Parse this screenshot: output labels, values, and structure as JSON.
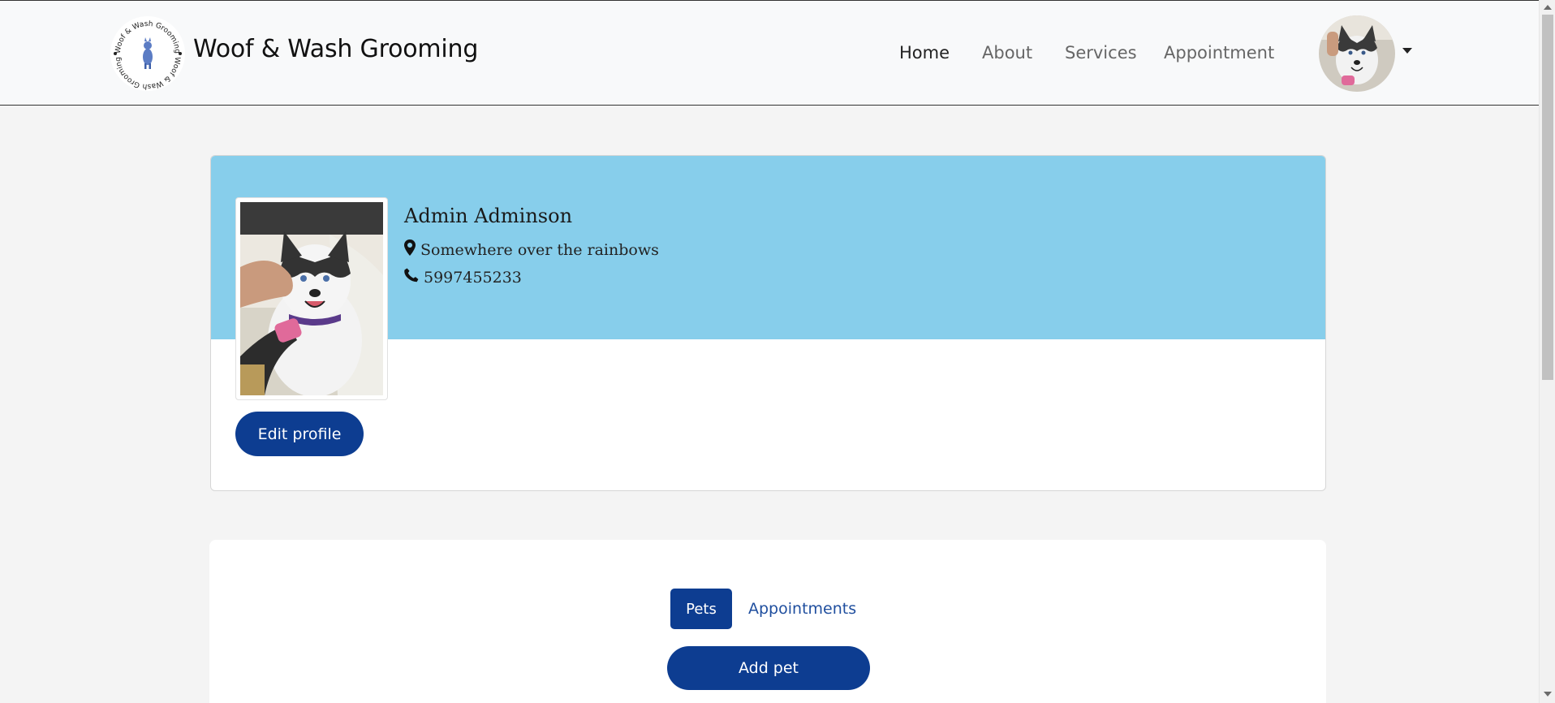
{
  "brand": {
    "title": "Woof & Wash Grooming",
    "logo_text": "Woof & Wash Grooming"
  },
  "nav": {
    "items": [
      {
        "label": "Home",
        "active": true
      },
      {
        "label": "About",
        "active": false
      },
      {
        "label": "Services",
        "active": false
      },
      {
        "label": "Appointment",
        "active": false
      }
    ]
  },
  "profile": {
    "name": "Admin Adminson",
    "location": "Somewhere over the rainbows",
    "phone": "5997455233",
    "edit_label": "Edit profile"
  },
  "tabs": {
    "items": [
      {
        "label": "Pets",
        "active": true
      },
      {
        "label": "Appointments",
        "active": false
      }
    ],
    "add_pet_label": "Add pet"
  },
  "colors": {
    "primary": "#0d3d91",
    "banner": "#87ceeb",
    "page_bg": "#f4f4f4",
    "navbar_bg": "#f8f9fa"
  },
  "icons": {
    "location": "map-marker-icon",
    "phone": "phone-icon",
    "dropdown": "caret-down-icon"
  }
}
